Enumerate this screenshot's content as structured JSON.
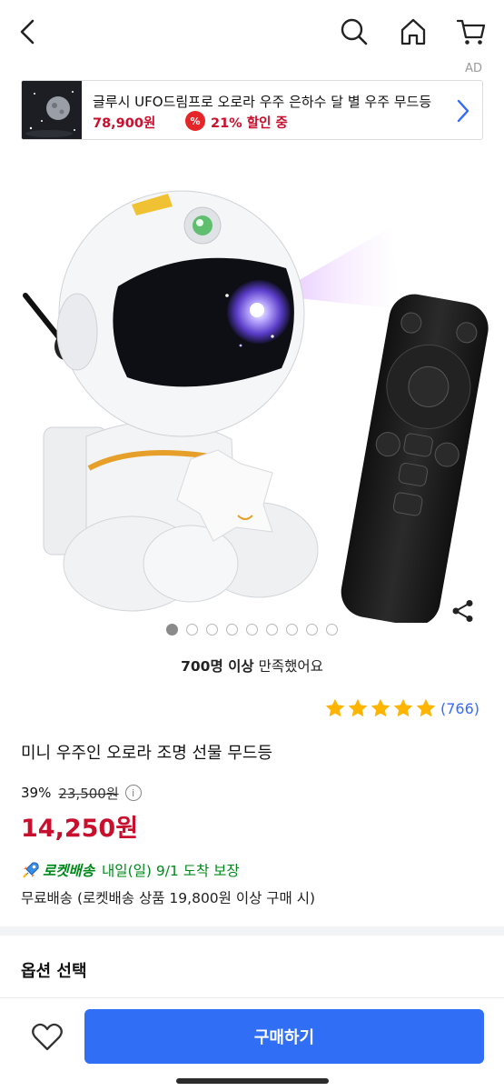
{
  "header": {
    "back_icon": "chevron-left-icon",
    "search_icon": "search-icon",
    "home_icon": "home-icon",
    "cart_icon": "cart-icon",
    "ad_label": "AD"
  },
  "ad": {
    "title": "글루시 UFO드림프로 오로라 우주 은하수 달 별 우주 무드등",
    "price": "78,900원",
    "percent_badge": "%",
    "discount": "21% 할인 중"
  },
  "gallery": {
    "image_count": 9,
    "active_index": 0,
    "share_icon": "share-icon"
  },
  "product": {
    "satisfied_bold": "700명 이상",
    "satisfied_text": " 만족했어요",
    "rating_stars": 5,
    "rating_count": "(766)",
    "title": "미니 우주인 오로라 조명 선물 무드등",
    "discount_rate": "39%",
    "original_price": "23,500원",
    "info_icon": "i",
    "sale_price": "14,250원"
  },
  "delivery": {
    "rocket_name": "로켓배송",
    "arrival": "내일(일) 9/1 도착 보장",
    "free_shipping": "무료배송 (로켓배송 상품 19,800원 이상 구매 시)"
  },
  "options": {
    "label": "옵션 선택"
  },
  "bottom": {
    "buy_label": "구매하기"
  },
  "colors": {
    "price_red": "#c8102e",
    "accent_blue": "#2f6ef5",
    "rocket_green": "#00891a",
    "star_yellow": "#ffb400",
    "review_blue": "#346aff"
  }
}
